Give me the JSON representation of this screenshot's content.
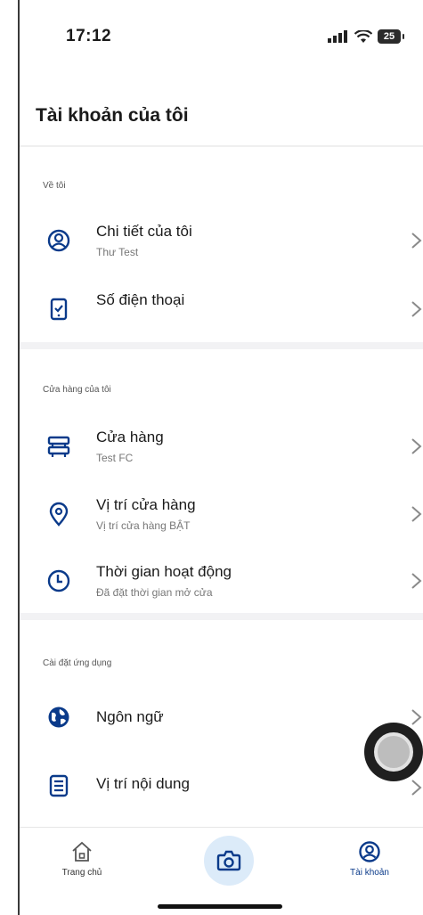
{
  "status_bar": {
    "time": "17:12",
    "battery": "25"
  },
  "header": {
    "title": "Tài khoản của tôi"
  },
  "sections": [
    {
      "label": "Về tôi",
      "items": [
        {
          "label": "Chi tiết của tôi",
          "sub": "Thư Test",
          "icon": "user-circle-icon"
        },
        {
          "label": "Số điện thoại",
          "sub": "",
          "icon": "phone-icon"
        }
      ]
    },
    {
      "label": "Cửa hàng của tôi",
      "items": [
        {
          "label": "Cửa hàng",
          "sub": "Test FC",
          "icon": "store-icon"
        },
        {
          "label": "Vị trí cửa hàng",
          "sub": "Vị trí cửa hàng BẬT",
          "icon": "location-pin-icon"
        },
        {
          "label": "Thời gian hoạt động",
          "sub": "Đã đặt thời gian mở cửa",
          "icon": "clock-icon"
        }
      ]
    },
    {
      "label": "Cài đặt ứng dụng",
      "items": [
        {
          "label": "Ngôn ngữ",
          "sub": "",
          "icon": "globe-icon"
        },
        {
          "label": "Vị trí nội dung",
          "sub": "",
          "icon": "document-icon"
        }
      ]
    }
  ],
  "tabbar": {
    "home_label": "Trang chủ",
    "account_label": "Tài khoản",
    "active_color": "#0a3a8a"
  }
}
